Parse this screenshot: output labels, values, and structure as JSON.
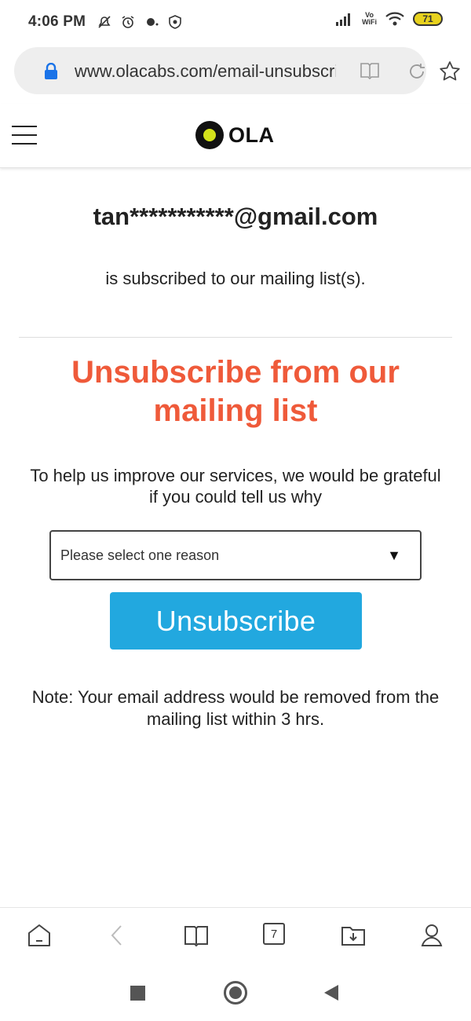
{
  "status_bar": {
    "time": "4:06 PM",
    "battery": "71",
    "vowifi_top": "Vo",
    "vowifi_bottom": "WiFi"
  },
  "browser": {
    "url": "www.olacabs.com/email-unsubscribe",
    "tab_count": "7"
  },
  "site": {
    "logo_text": "OLA",
    "brand_colors": {
      "logo_accent": "#d4e21b",
      "title_accent": "#ef5a3a",
      "button": "#22a8df"
    }
  },
  "main": {
    "email": "tan***********@gmail.com",
    "subscribed_text": "is subscribed to our mailing list(s).",
    "title": "Unsubscribe from our mailing list",
    "help_text": "To help us improve our services, we would be grateful if you could tell us why",
    "select_placeholder": "Please select one reason",
    "select_arrow": "▼",
    "button_label": "Unsubscribe",
    "note": "Note: Your email address would be removed from the mailing list within 3 hrs."
  }
}
